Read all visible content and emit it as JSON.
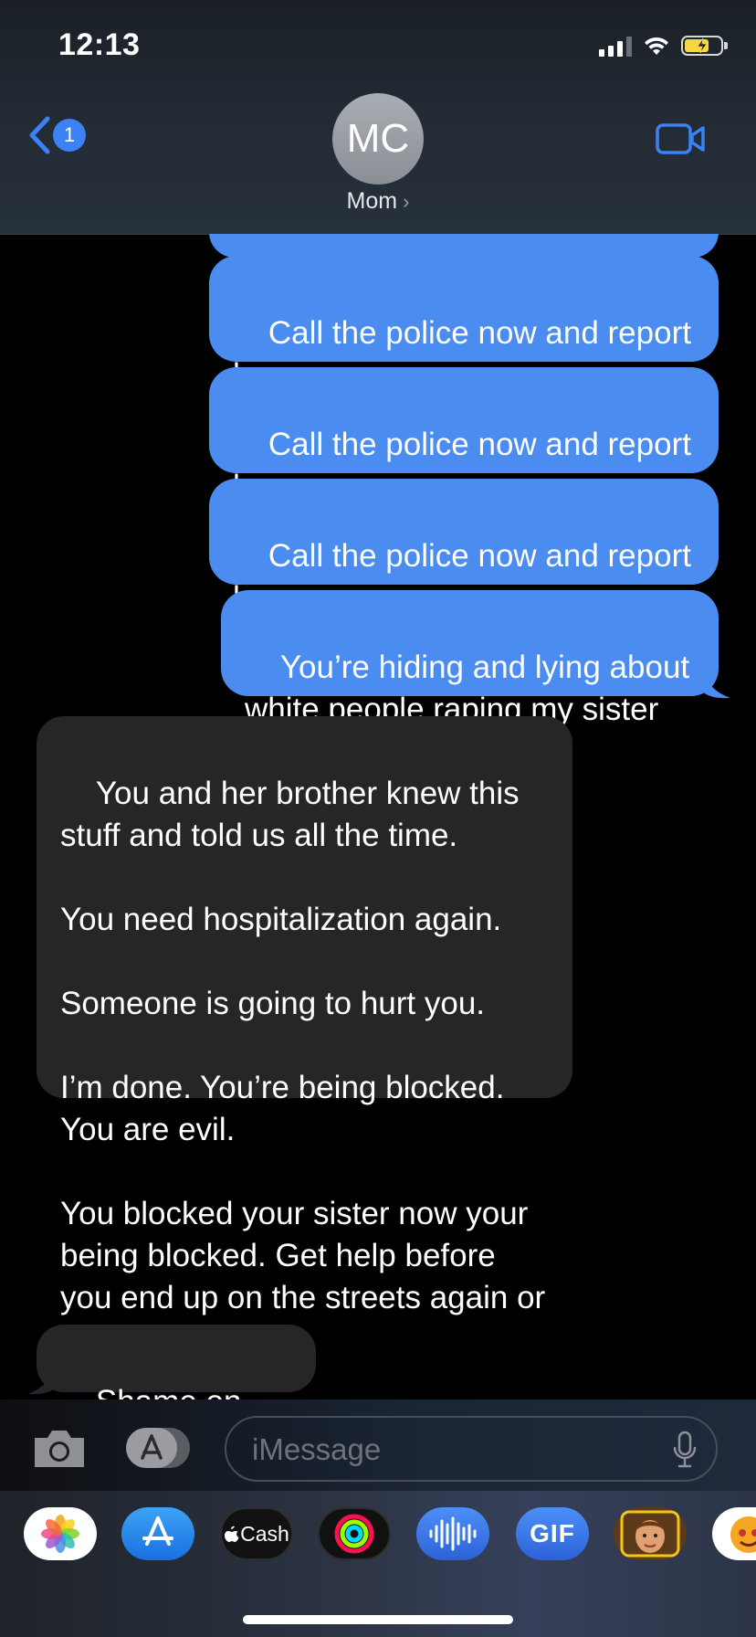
{
  "status_bar": {
    "time": "12:13"
  },
  "header": {
    "back_badge": "1",
    "avatar_initials": "MC",
    "contact_name": "Mom",
    "chevron": "›"
  },
  "messages": [
    {
      "direction": "outgoing",
      "text": ""
    },
    {
      "direction": "outgoing",
      "text": "Call the police now and report her rape"
    },
    {
      "direction": "outgoing",
      "text": "Call the police now and report her rape"
    },
    {
      "direction": "outgoing",
      "text": "Call the police now and report her rape"
    },
    {
      "direction": "outgoing",
      "text": "You’re hiding and lying about white people raping my sister"
    },
    {
      "direction": "incoming",
      "text": "You and her brother knew this stuff and told us all the time.\n\nYou need hospitalization again.\n\nSomeone is going to hurt you.\n\nI’m done. You’re being blocked. You are evil.\n\nYou blocked your sister now your being blocked. Get help before you end up on the streets again or dead."
    },
    {
      "direction": "incoming",
      "text": "Shame on you !"
    }
  ],
  "input_bar": {
    "placeholder": "iMessage"
  },
  "app_drawer": {
    "cash_label": "Cash",
    "gif_label": "GIF",
    "apps": [
      "photos-icon",
      "app-store-icon",
      "apple-cash-icon",
      "activity-icon",
      "audio-message-icon",
      "gif-icon",
      "memoji-icon",
      "animoji-icon"
    ]
  },
  "colors": {
    "outgoing": "#4a8cf0",
    "incoming": "#262628",
    "accent": "#3b82f6"
  }
}
